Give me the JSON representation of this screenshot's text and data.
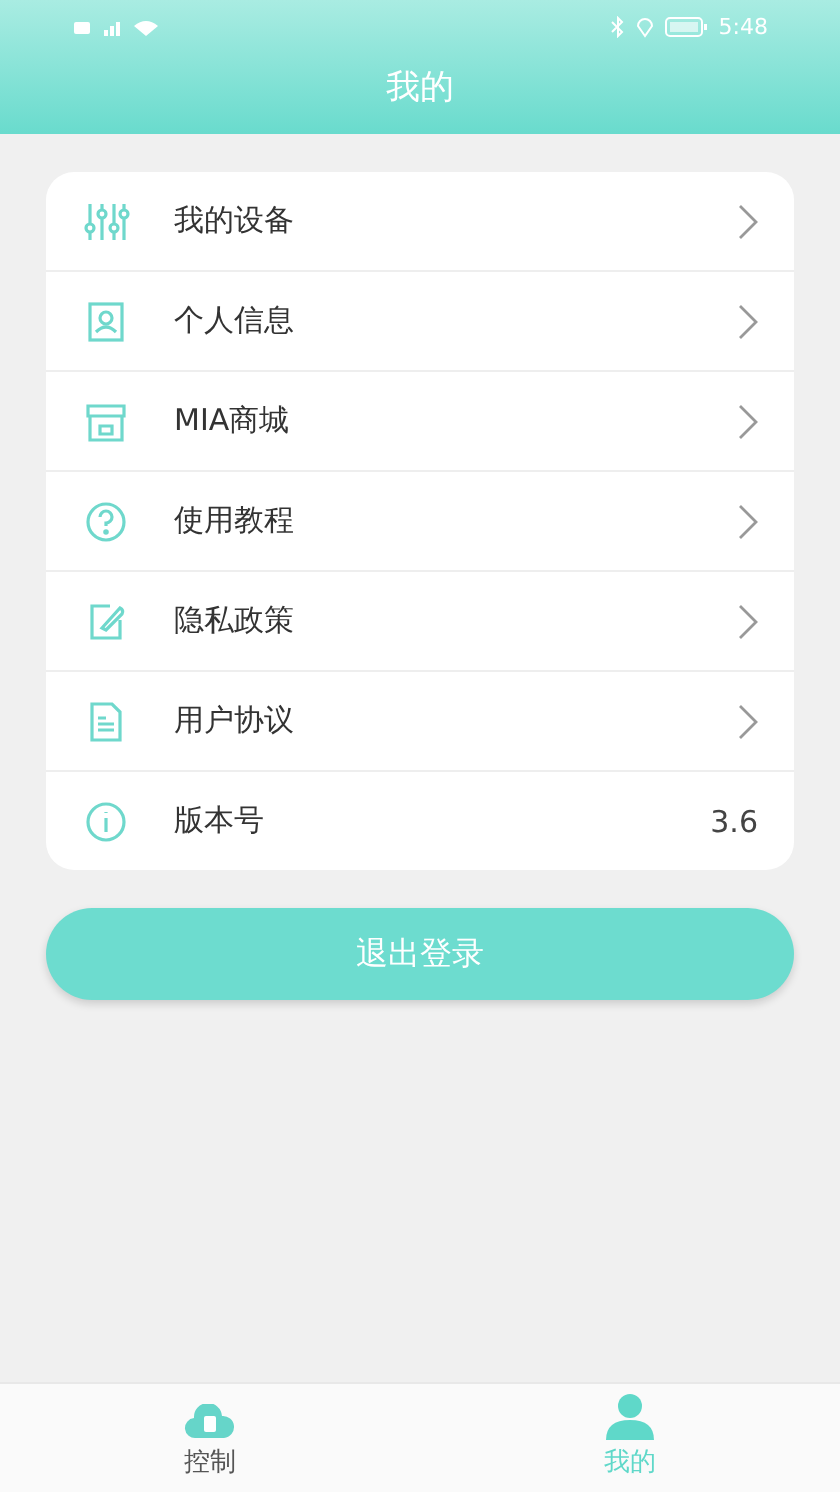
{
  "status_bar": {
    "time": "5:48"
  },
  "header": {
    "title": "我的"
  },
  "menu": [
    {
      "label": "我的设备",
      "kind": "link"
    },
    {
      "label": "个人信息",
      "kind": "link"
    },
    {
      "label": "MIA商城",
      "kind": "link"
    },
    {
      "label": "使用教程",
      "kind": "link"
    },
    {
      "label": "隐私政策",
      "kind": "link"
    },
    {
      "label": "用户协议",
      "kind": "link"
    },
    {
      "label": "版本号",
      "kind": "value",
      "value": "3.6"
    }
  ],
  "logout_button": "退出登录",
  "tabs": [
    {
      "label": "控制",
      "selected": false
    },
    {
      "label": "我的",
      "selected": true
    }
  ]
}
